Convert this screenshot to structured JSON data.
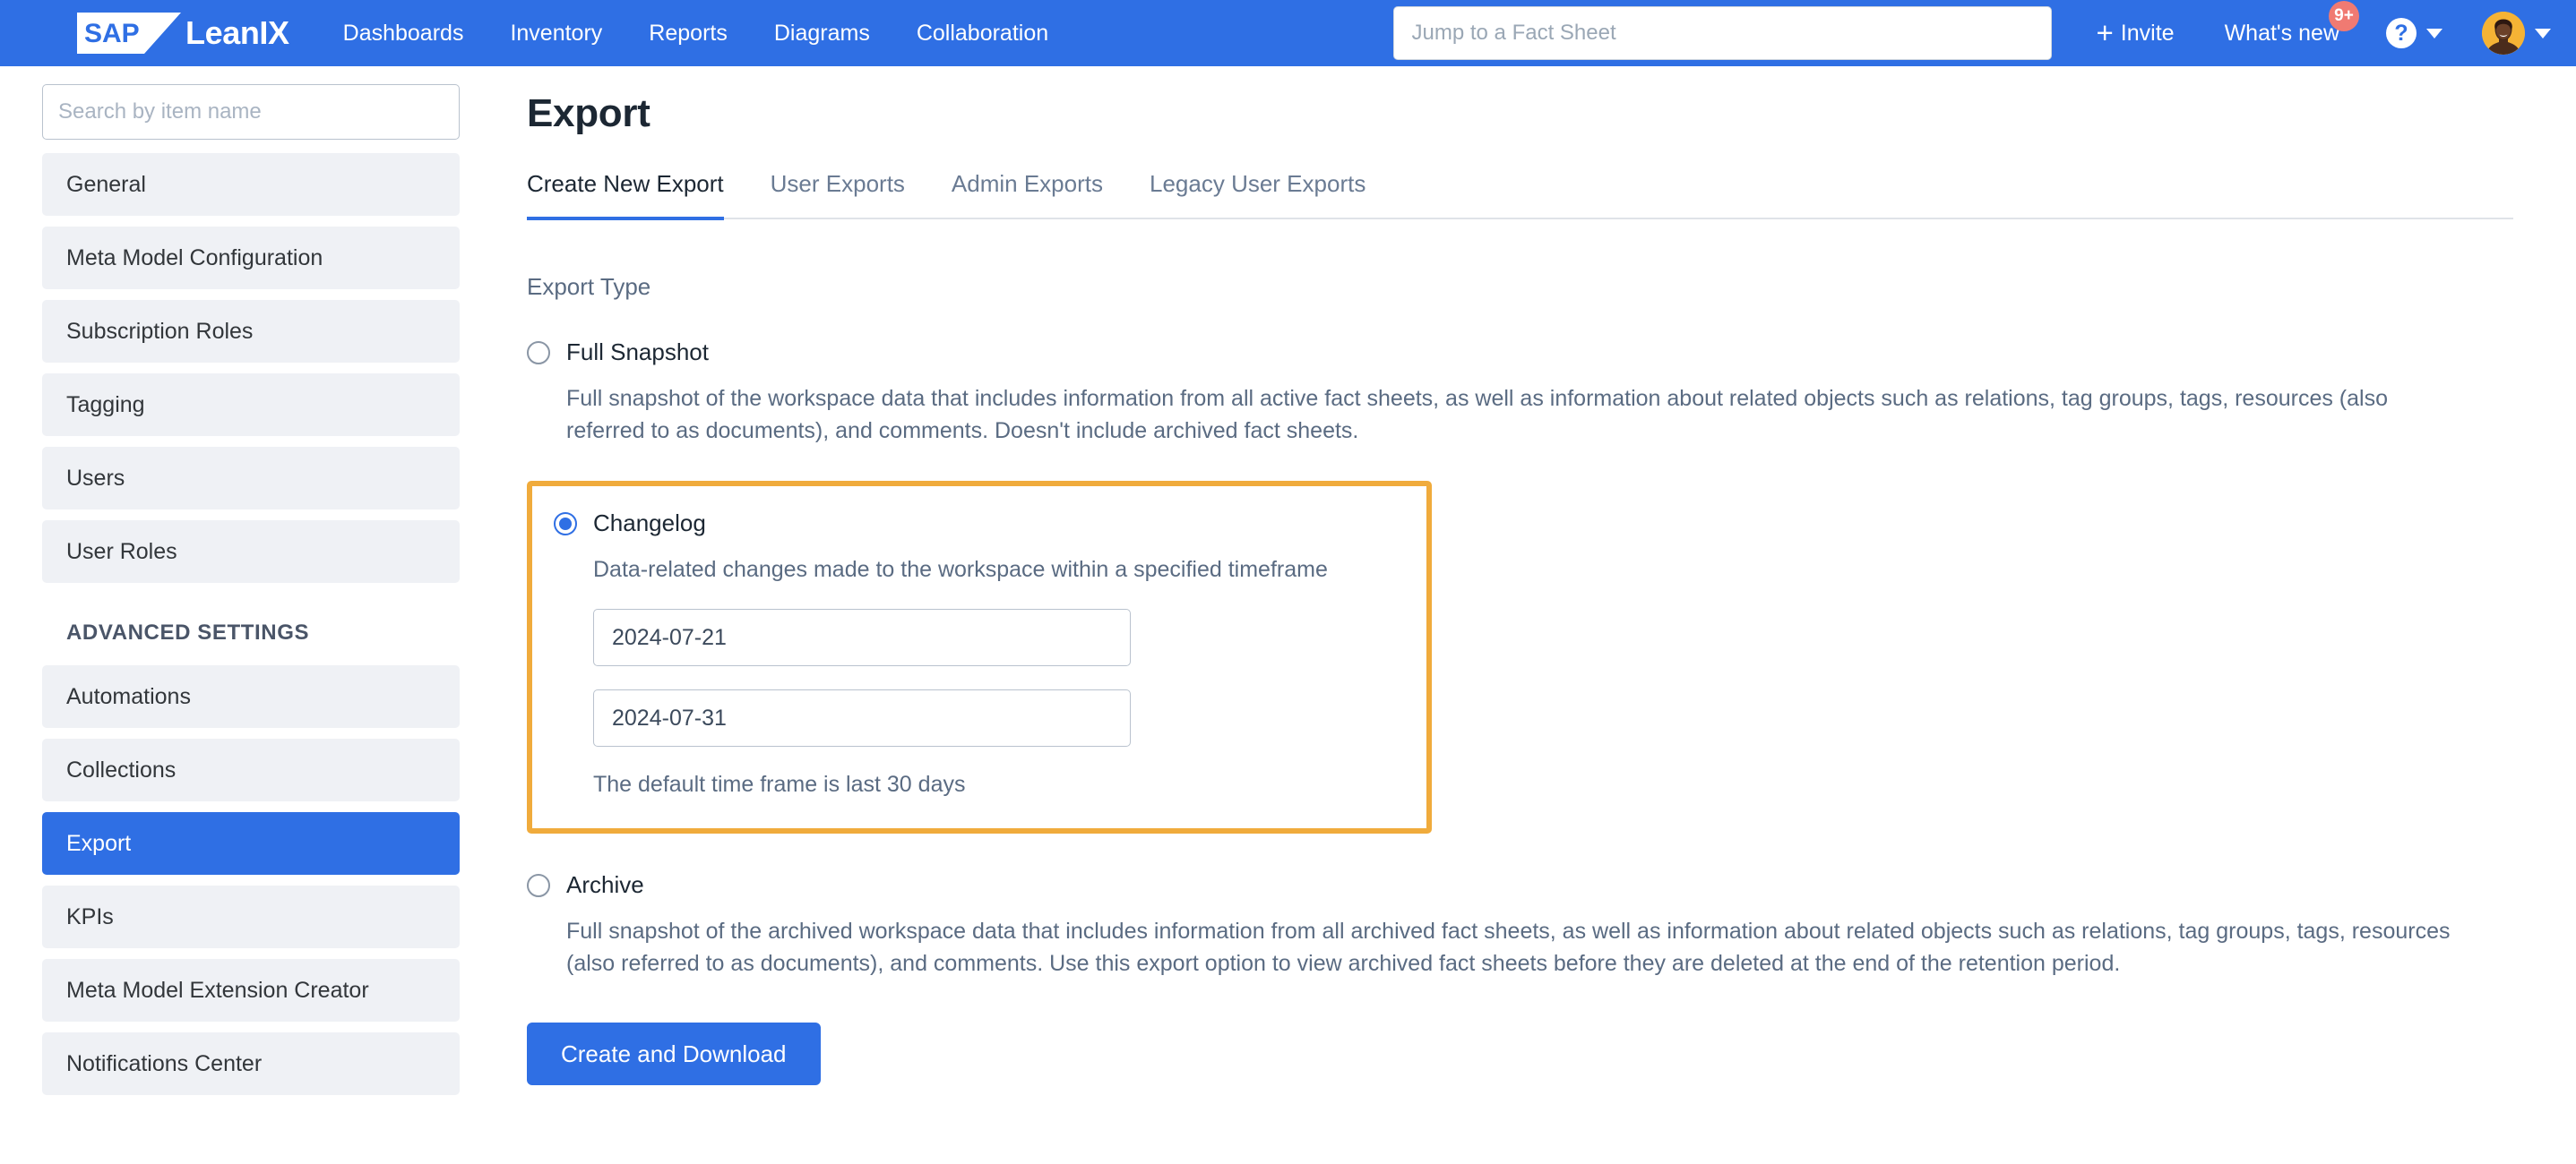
{
  "topnav": {
    "brand": {
      "logo_text": "SAP",
      "product": "LeanIX"
    },
    "links": [
      "Dashboards",
      "Inventory",
      "Reports",
      "Diagrams",
      "Collaboration"
    ],
    "search_placeholder": "Jump to a Fact Sheet",
    "search_value": "",
    "invite_label": "Invite",
    "invite_plus": "+",
    "whats_new_label": "What's new",
    "whats_new_badge": "9+",
    "help_glyph": "?"
  },
  "sidebar": {
    "search_placeholder": "Search by item name",
    "search_value": "",
    "items": [
      {
        "label": "General",
        "active": false
      },
      {
        "label": "Meta Model Configuration",
        "active": false
      },
      {
        "label": "Subscription Roles",
        "active": false
      },
      {
        "label": "Tagging",
        "active": false
      },
      {
        "label": "Users",
        "active": false
      },
      {
        "label": "User Roles",
        "active": false
      }
    ],
    "advanced_title": "ADVANCED SETTINGS",
    "advanced_items": [
      {
        "label": "Automations",
        "active": false
      },
      {
        "label": "Collections",
        "active": false
      },
      {
        "label": "Export",
        "active": true
      },
      {
        "label": "KPIs",
        "active": false
      },
      {
        "label": "Meta Model Extension Creator",
        "active": false
      },
      {
        "label": "Notifications Center",
        "active": false
      }
    ]
  },
  "main": {
    "page_title": "Export",
    "tabs": [
      {
        "label": "Create New Export",
        "active": true
      },
      {
        "label": "User Exports",
        "active": false
      },
      {
        "label": "Admin Exports",
        "active": false
      },
      {
        "label": "Legacy User Exports",
        "active": false
      }
    ],
    "export_type_label": "Export Type",
    "options": {
      "full_snapshot": {
        "title": "Full Snapshot",
        "selected": false,
        "description": "Full snapshot of the workspace data that includes information from all active fact sheets, as well as information about related objects such as relations, tag groups, tags, resources (also referred to as documents), and comments. Doesn't include archived fact sheets."
      },
      "changelog": {
        "title": "Changelog",
        "selected": true,
        "description": "Data-related changes made to the workspace within a specified timeframe",
        "start_date": "2024-07-21",
        "end_date": "2024-07-31",
        "hint": "The default time frame is last 30 days"
      },
      "archive": {
        "title": "Archive",
        "selected": false,
        "description": "Full snapshot of the archived workspace data that includes information from all archived fact sheets, as well as information about related objects such as relations, tag groups, tags, resources (also referred to as documents), and comments. Use this export option to view archived fact sheets before they are deleted at the end of the retention period."
      }
    },
    "submit_label": "Create and Download"
  },
  "colors": {
    "brand_blue": "#2F6FE4",
    "highlight_orange": "#F0AB3C",
    "badge_red": "#F07A72",
    "sidebar_item_bg": "#eff1f5"
  }
}
